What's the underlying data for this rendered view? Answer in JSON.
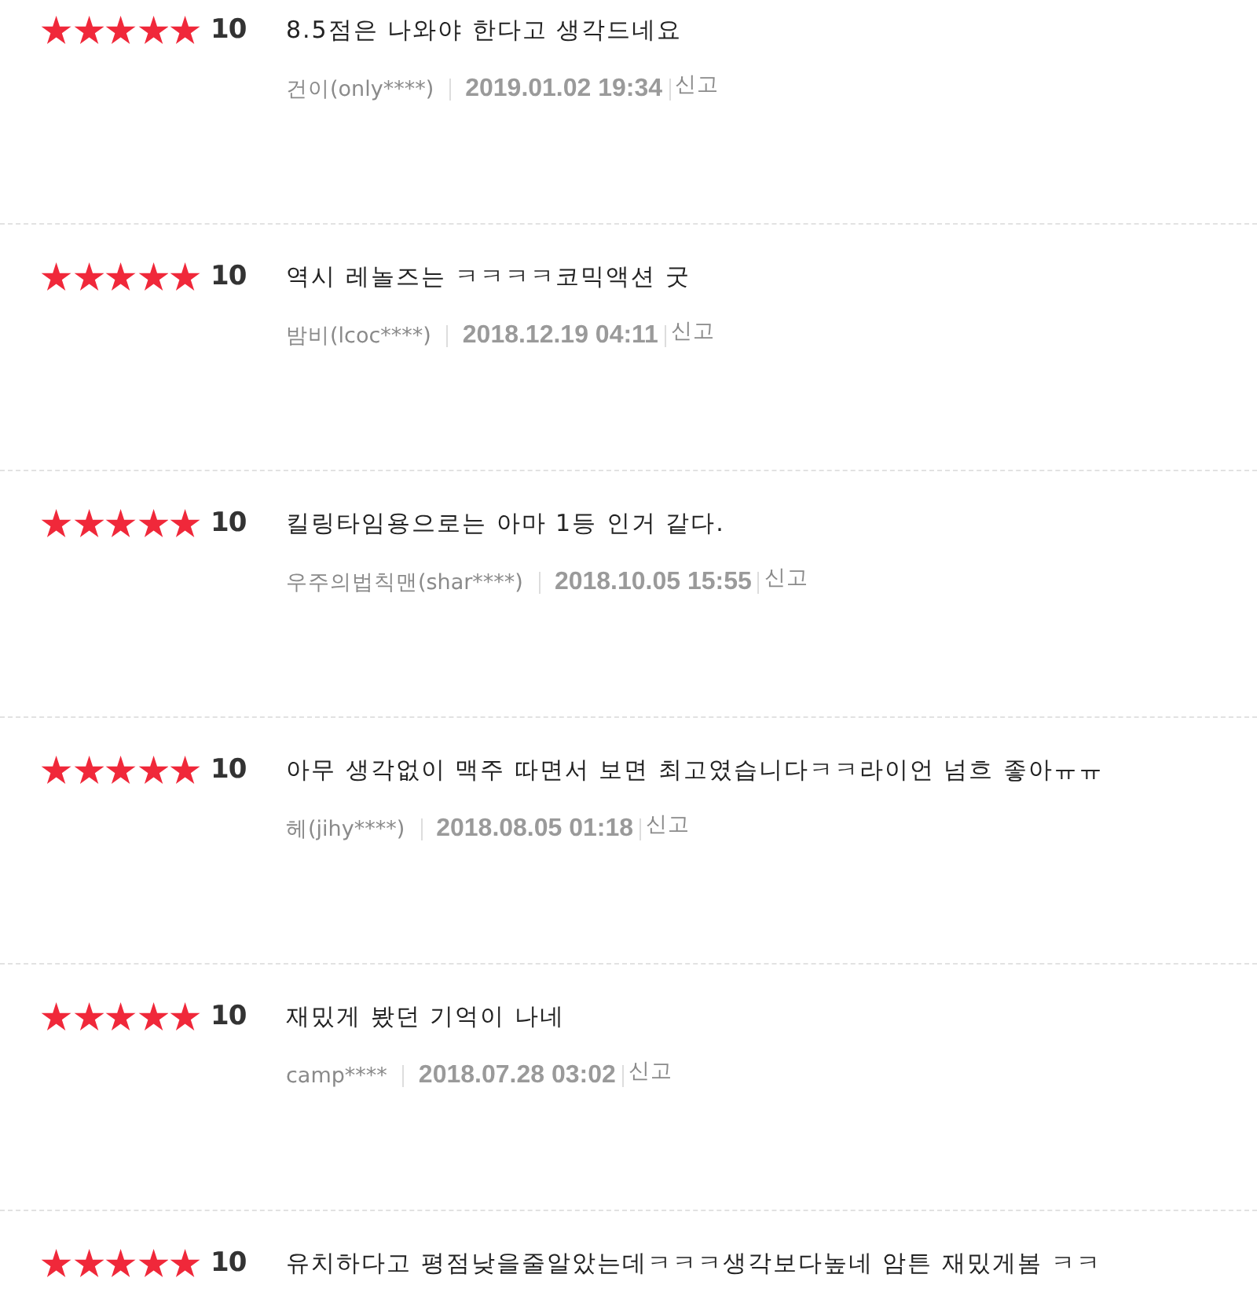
{
  "reviews": [
    {
      "stars": 5,
      "score": "10",
      "comment": "8.5점은 나와야 한다고 생각드네요",
      "nickname": "건이(only****)",
      "date": "2019.01.02 19:34",
      "report": "신고"
    },
    {
      "stars": 5,
      "score": "10",
      "comment": "역시 레놀즈는 ㅋㅋㅋㅋ코믹액션 굿",
      "nickname": "밤비(lcoc****)",
      "date": "2018.12.19 04:11",
      "report": "신고"
    },
    {
      "stars": 5,
      "score": "10",
      "comment": "킬링타임용으로는 아마 1등 인거 같다.",
      "nickname": "우주의법칙맨(shar****)",
      "date": "2018.10.05 15:55",
      "report": "신고"
    },
    {
      "stars": 5,
      "score": "10",
      "comment": "아무 생각없이 맥주 따면서 보면 최고였습니다ㅋㅋ라이언 넘흐 좋아ㅠㅠ",
      "nickname": "헤(jihy****)",
      "date": "2018.08.05 01:18",
      "report": "신고"
    },
    {
      "stars": 5,
      "score": "10",
      "comment": "재밌게 봤던 기억이 나네",
      "nickname": "camp****",
      "date": "2018.07.28 03:02",
      "report": "신고"
    },
    {
      "stars": 5,
      "score": "10",
      "comment": "유치하다고 평점낮을줄알았는데ㅋㅋㅋ생각보다높네 암튼 재밌게봄 ㅋㅋ"
    }
  ]
}
